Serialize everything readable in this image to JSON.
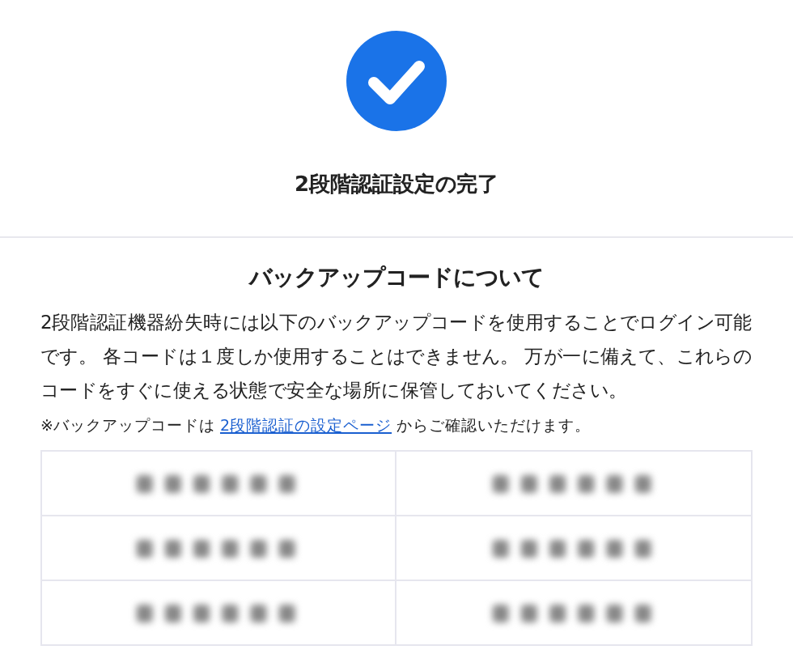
{
  "dialog": {
    "completed": true,
    "title": "2段階認証設定の完了"
  },
  "section": {
    "heading": "バックアップコードについて",
    "paragraph": "2段階認証機器紛失時には以下のバックアップコードを使用することでログイン可能です。 各コードは１度しか使用することはできません。 万が一に備えて、これらのコードをすぐに使える状態で安全な場所に保管しておいてください。",
    "note": {
      "before": "※バックアップコードは ",
      "link": "2段階認証の設定ページ",
      "after": " からご確認いただけます。"
    }
  },
  "codes": [
    {
      "kind": "blurred"
    },
    {
      "kind": "blurred"
    },
    {
      "kind": "blurred"
    },
    {
      "kind": "blurred"
    },
    {
      "kind": "blurred"
    },
    {
      "kind": "blurred"
    }
  ]
}
